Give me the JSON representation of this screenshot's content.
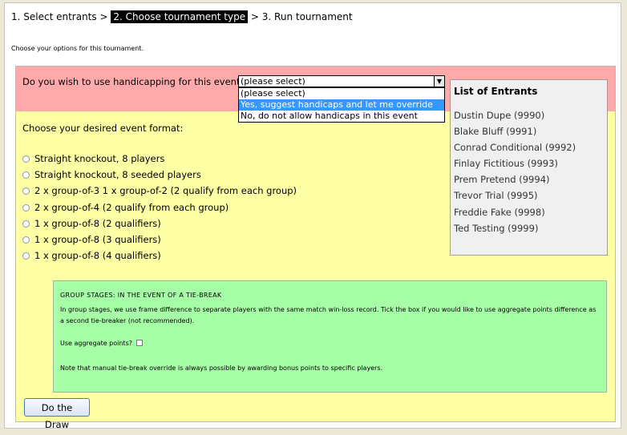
{
  "steps": {
    "step1": "1. Select entrants",
    "sep1": ">",
    "step2": "2. Choose tournament type",
    "sep2": ">",
    "step3": "3. Run tournament"
  },
  "intro": "Choose your options for this tournament.",
  "handicap": {
    "question": "Do you wish to use handicapping for this event?",
    "selected_value": "(please select)",
    "options": [
      "(please select)",
      "Yes, suggest handicaps and let me override",
      "No, do not allow handicaps in this event"
    ],
    "highlighted_index": 1
  },
  "format": {
    "label": "Choose your desired event format:",
    "options": [
      "Straight knockout, 8 players",
      "Straight knockout, 8 seeded players",
      "2 x group-of-3 1 x group-of-2 (2 qualify from each group)",
      "2 x group-of-4 (2 qualify from each group)",
      "1 x group-of-8 (2 qualifiers)",
      "1 x group-of-8 (3 qualifiers)",
      "1 x group-of-8 (4 qualifiers)"
    ]
  },
  "entrants": {
    "title": "List of Entrants",
    "items": [
      "Dustin Dupe (9990)",
      "Blake Bluff (9991)",
      "Conrad Conditional (9992)",
      "Finlay Fictitious (9993)",
      "Prem Pretend (9994)",
      "Trevor Trial (9995)",
      "Freddie Fake (9998)",
      "Ted Testing (9999)"
    ]
  },
  "tiebreak": {
    "title": "GROUP STAGES: IN THE EVENT OF A TIE-BREAK",
    "text": "In group stages, we use frame difference to separate players with the same match win-loss record. Tick the box if you would like to use aggregate points difference as a second tie-breaker (not recommended).",
    "aggregate_label": "Use aggregate points?",
    "note": "Note that manual tie-break override is always possible by awarding bonus points to specific players."
  },
  "draw_button": "Do the Draw",
  "colors": {
    "handicap_row": "#ffaaaa",
    "form_bg": "#ffffa6",
    "tiebreak_bg": "#a6ffa6",
    "highlight": "#3399ff"
  }
}
